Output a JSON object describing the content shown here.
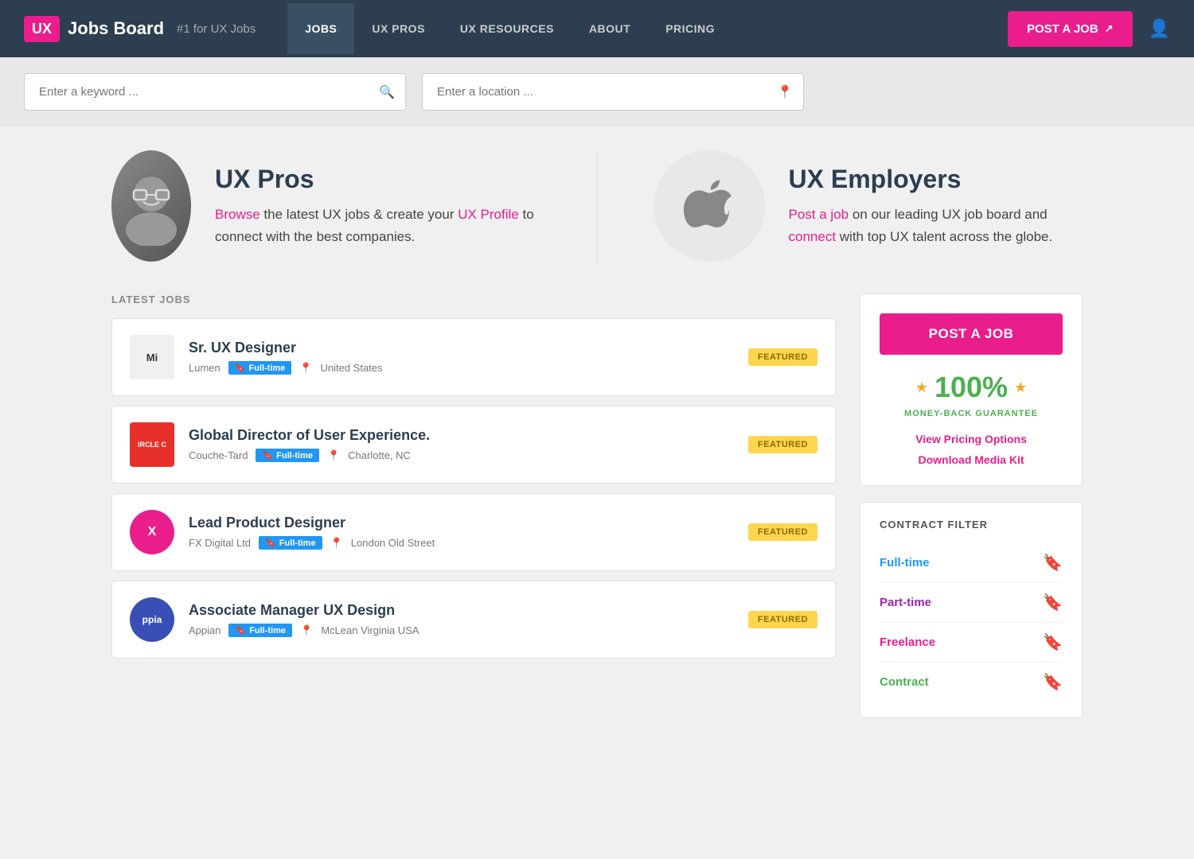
{
  "navbar": {
    "logo_text": "UX",
    "brand_name": "Jobs Board",
    "tagline": "#1 for UX Jobs",
    "links": [
      {
        "label": "JOBS",
        "active": true
      },
      {
        "label": "UX PROS",
        "active": false
      },
      {
        "label": "UX RESOURCES",
        "active": false
      },
      {
        "label": "ABOUT",
        "active": false
      },
      {
        "label": "PRICING",
        "active": false
      }
    ],
    "post_job_label": "POST A JOB"
  },
  "search": {
    "keyword_placeholder": "Enter a keyword ...",
    "location_placeholder": "Enter a location ..."
  },
  "promo": {
    "ux_pros_title": "UX Pros",
    "ux_pros_desc_1": "Browse",
    "ux_pros_desc_2": " the latest UX jobs & create your ",
    "ux_pros_desc_3": "UX Profile",
    "ux_pros_desc_4": " to connect with the best companies.",
    "ux_employers_title": "UX Employers",
    "ux_employers_desc_1": "Post a job",
    "ux_employers_desc_2": " on our leading UX job board and ",
    "ux_employers_desc_3": "connect",
    "ux_employers_desc_4": " with top UX talent across the globe."
  },
  "jobs": {
    "section_label": "LATEST JOBS",
    "items": [
      {
        "id": 1,
        "title": "Sr. UX Designer",
        "company": "Lumen",
        "type": "Full-time",
        "location": "United States",
        "featured": true,
        "logo_text": "Mi",
        "logo_class": "logo-lumen"
      },
      {
        "id": 2,
        "title": "Global Director of User Experience.",
        "company": "Couche-Tard",
        "type": "Full-time",
        "location": "Charlotte, NC",
        "featured": true,
        "logo_text": "IRCLE C",
        "logo_class": "logo-circle"
      },
      {
        "id": 3,
        "title": "Lead Product Designer",
        "company": "FX Digital Ltd",
        "type": "Full-time",
        "location": "London Old Street",
        "featured": true,
        "logo_text": "X",
        "logo_class": "logo-fx"
      },
      {
        "id": 4,
        "title": "Associate Manager UX Design",
        "company": "Appian",
        "type": "Full-time",
        "location": "McLean Virginia USA",
        "featured": true,
        "logo_text": "ppia",
        "logo_class": "logo-appian"
      }
    ],
    "featured_label": "FEATURED"
  },
  "sidebar": {
    "post_job_btn": "POST A JOB",
    "guarantee_pct": "100%",
    "guarantee_label": "MONEY-BACK GUARANTEE",
    "view_pricing": "View Pricing Options",
    "download_media": "Download Media Kit",
    "contract_filter_title": "CONTRACT FILTER",
    "filter_items": [
      {
        "label": "Full-time",
        "class": "filter-fulltime",
        "icon": "🔖"
      },
      {
        "label": "Part-time",
        "class": "filter-parttime",
        "icon": "🔖"
      },
      {
        "label": "Freelance",
        "class": "filter-freelance",
        "icon": "🔖"
      },
      {
        "label": "Contract",
        "class": "filter-contract",
        "icon": "🔖"
      }
    ]
  }
}
